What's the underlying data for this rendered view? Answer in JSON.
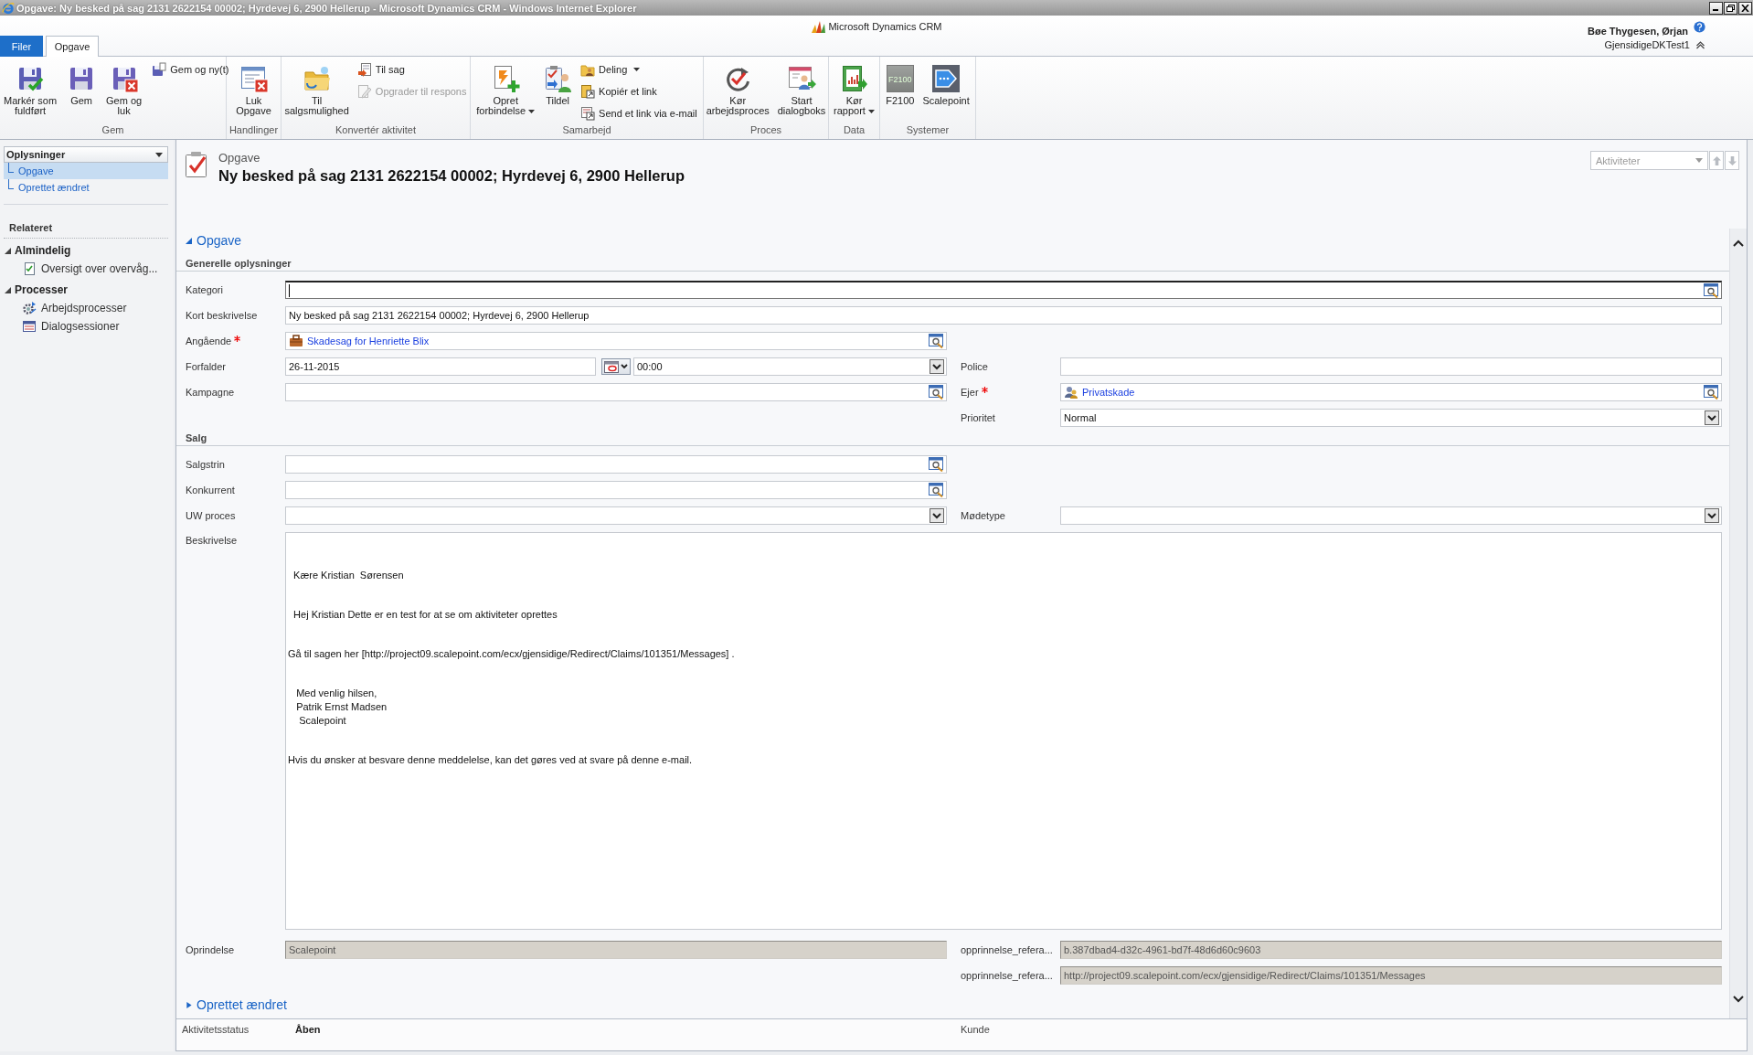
{
  "window": {
    "title": "Opgave: Ny besked på sag 2131 2622154 00002; Hyrdevej 6, 2900 Hellerup - Microsoft Dynamics CRM - Windows Internet Explorer"
  },
  "header": {
    "product": "Microsoft Dynamics CRM",
    "user": "Bøe Thygesen, Ørjan",
    "organization": "GjensidigeDKTest1"
  },
  "tabs": [
    {
      "label": "Filer",
      "kind": "file",
      "selected": false
    },
    {
      "label": "Opgave",
      "kind": "page",
      "selected": true
    }
  ],
  "ribbon": {
    "groups": [
      {
        "label": "Gem",
        "items": [
          {
            "kind": "large",
            "lines": [
              "Markér som",
              "fuldført"
            ],
            "dropdown": false,
            "disabled": false
          },
          {
            "kind": "large",
            "lines": [
              "Gem"
            ],
            "dropdown": false,
            "disabled": false
          },
          {
            "kind": "large",
            "lines": [
              "Gem og",
              "luk"
            ],
            "dropdown": false,
            "disabled": false
          },
          {
            "kind": "small",
            "label": "Gem og ny(t)",
            "dropdown": false,
            "disabled": false
          }
        ]
      },
      {
        "label": "Handlinger",
        "items": [
          {
            "kind": "large",
            "lines": [
              "Luk",
              "Opgave"
            ],
            "dropdown": false,
            "disabled": false
          }
        ]
      },
      {
        "label": "Konvertér aktivitet",
        "items": [
          {
            "kind": "large",
            "lines": [
              "Til",
              "salgsmulighed"
            ],
            "dropdown": false,
            "disabled": false
          },
          {
            "kind": "small",
            "label": "Til sag",
            "dropdown": false,
            "disabled": false
          },
          {
            "kind": "small",
            "label": "Opgrader til respons",
            "dropdown": false,
            "disabled": true
          }
        ]
      },
      {
        "label": "Samarbejd",
        "items": [
          {
            "kind": "large",
            "lines": [
              "Opret",
              "forbindelse"
            ],
            "dropdown": true,
            "disabled": false
          },
          {
            "kind": "large",
            "lines": [
              "Tildel"
            ],
            "dropdown": false,
            "disabled": false
          },
          {
            "kind": "small",
            "label": "Deling",
            "dropdown": true,
            "disabled": false
          },
          {
            "kind": "small",
            "label": "Kopiér et link",
            "dropdown": false,
            "disabled": false
          },
          {
            "kind": "small",
            "label": "Send et link via e-mail",
            "dropdown": false,
            "disabled": false
          }
        ]
      },
      {
        "label": "Proces",
        "items": [
          {
            "kind": "large",
            "lines": [
              "Kør",
              "arbejdsproces"
            ],
            "dropdown": false,
            "disabled": false
          },
          {
            "kind": "large",
            "lines": [
              "Start",
              "dialogboks"
            ],
            "dropdown": false,
            "disabled": false
          }
        ]
      },
      {
        "label": "Data",
        "items": [
          {
            "kind": "large",
            "lines": [
              "Kør",
              "rapport"
            ],
            "dropdown": true,
            "disabled": false
          }
        ]
      },
      {
        "label": "Systemer",
        "items": [
          {
            "kind": "large",
            "lines": [
              "F2100"
            ],
            "tile_text": "F2100",
            "dropdown": false,
            "disabled": false
          },
          {
            "kind": "large",
            "lines": [
              "Scalepoint"
            ],
            "dropdown": false,
            "disabled": false
          }
        ]
      }
    ]
  },
  "nav": {
    "menu": {
      "label": "Oplysninger",
      "items": [
        {
          "label": "Opgave",
          "selected": true
        },
        {
          "label": "Oprettet ændret",
          "selected": false
        }
      ]
    },
    "related": "Relateret",
    "groups": [
      {
        "label": "Almindelig",
        "expanded": true,
        "items": [
          {
            "label": "Oversigt over overvåg..."
          }
        ]
      },
      {
        "label": "Processer",
        "expanded": true,
        "items": [
          {
            "label": "Arbejdsprocesser"
          },
          {
            "label": "Dialogsessioner"
          }
        ]
      }
    ]
  },
  "record": {
    "entity": "Opgave",
    "title": "Ny besked på sag 2131 2622154 00002; Hyrdevej 6, 2900 Hellerup",
    "navigator": {
      "label": "Aktiviteter",
      "disabled": true
    }
  },
  "form": {
    "sections": [
      {
        "title": "Opgave",
        "expanded": true,
        "subsections": [
          {
            "title": "Generelle oplysninger",
            "rows": [
              {
                "full": {
                  "label": "Kategori",
                  "kind": "lookup",
                  "required": false,
                  "focused": true,
                  "disabled": false
                }
              },
              {
                "full": {
                  "label": "Kort beskrivelse",
                  "kind": "text",
                  "value": "Ny besked på sag 2131 2622154 00002; Hyrdevej 6, 2900 Hellerup",
                  "required": false,
                  "focused": false,
                  "disabled": false
                }
              },
              {
                "left": {
                  "label": "Angående",
                  "kind": "lookup",
                  "value": "Skadesag for Henriette Blix",
                  "required": true,
                  "focused": false,
                  "disabled": false
                }
              },
              {
                "left": {
                  "label": "Forfalder",
                  "kind": "datetime",
                  "date": "26-11-2015",
                  "time": "00:00",
                  "required": false,
                  "focused": false,
                  "disabled": false
                },
                "right": {
                  "label": "Police",
                  "kind": "text",
                  "required": false,
                  "focused": false,
                  "disabled": false
                }
              },
              {
                "left": {
                  "label": "Kampagne",
                  "kind": "lookup",
                  "required": false,
                  "focused": false,
                  "disabled": false
                },
                "right": {
                  "label": "Ejer",
                  "kind": "lookup",
                  "value": "Privatskade",
                  "required": true,
                  "focused": false,
                  "disabled": false
                }
              },
              {
                "right": {
                  "label": "Prioritet",
                  "kind": "select",
                  "value": "Normal",
                  "required": false,
                  "focused": false,
                  "disabled": false
                }
              }
            ]
          },
          {
            "title": "Salg",
            "rows": [
              {
                "left": {
                  "label": "Salgstrin",
                  "kind": "lookup",
                  "required": false,
                  "focused": false,
                  "disabled": false
                }
              },
              {
                "left": {
                  "label": "Konkurrent",
                  "kind": "lookup",
                  "required": false,
                  "focused": false,
                  "disabled": false
                }
              },
              {
                "left": {
                  "label": "UW proces",
                  "kind": "select",
                  "required": false,
                  "focused": false,
                  "disabled": false
                },
                "right": {
                  "label": "Mødetype",
                  "kind": "select",
                  "required": false,
                  "focused": false,
                  "disabled": false
                }
              },
              {
                "full": {
                  "label": "Beskrivelse",
                  "kind": "textarea",
                  "paragraphs": [
                    "  Kære Kristian  Sørensen",
                    "  Hej Kristian Dette er en test for at se om aktiviteter oprettes",
                    "Gå til sagen her [http://project09.scalepoint.com/ecx/gjensidige/Redirect/Claims/101351/Messages] .",
                    "   Med venlig hilsen,\n   Patrik Ernst Madsen\n    Scalepoint",
                    "Hvis du ønsker at besvare denne meddelelse, kan det gøres ved at svare på denne e-mail."
                  ],
                  "required": false,
                  "focused": false,
                  "disabled": false
                }
              },
              {
                "left": {
                  "label": "Oprindelse",
                  "kind": "text",
                  "value": "Scalepoint",
                  "required": false,
                  "focused": false,
                  "disabled": true
                },
                "right": {
                  "label": "opprinnelse_refera...",
                  "kind": "text",
                  "value": "b.387dbad4-d32c-4961-bd7f-48d6d60c9603",
                  "required": false,
                  "focused": false,
                  "disabled": true
                }
              },
              {
                "right": {
                  "label": "opprinnelse_refera...",
                  "kind": "text",
                  "value": "http://project09.scalepoint.com/ecx/gjensidige/Redirect/Claims/101351/Messages",
                  "required": false,
                  "focused": false,
                  "disabled": true
                }
              }
            ]
          }
        ]
      },
      {
        "title": "Oprettet ændret",
        "expanded": false
      }
    ]
  },
  "footer": {
    "fields": [
      {
        "label": "Aktivitetsstatus",
        "value": "Åben"
      },
      {
        "label": "Kunde"
      }
    ]
  }
}
